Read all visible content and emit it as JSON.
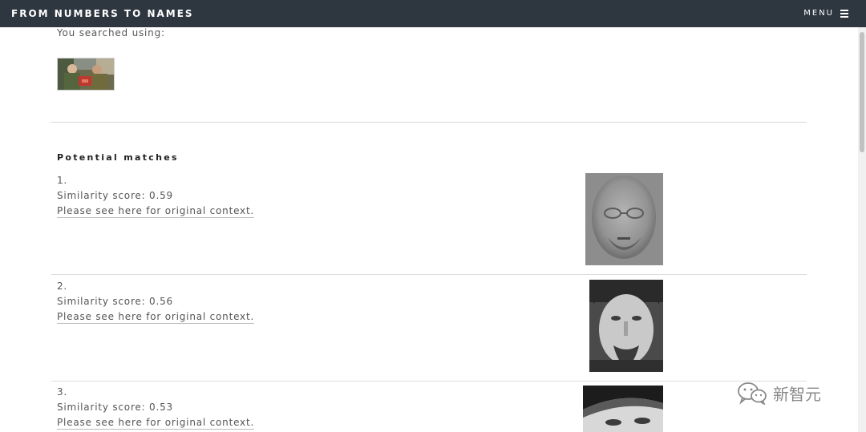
{
  "header": {
    "brand": "FROM NUMBERS TO NAMES",
    "menu_label": "MENU",
    "menu_icon": "hamburger-icon"
  },
  "search": {
    "label": "You searched using:"
  },
  "results": {
    "title": "Potential matches",
    "link_text": "Please see here for original context.",
    "matches": [
      {
        "rank": "1.",
        "score": "Similarity score: 0.59"
      },
      {
        "rank": "2.",
        "score": "Similarity score: 0.56"
      },
      {
        "rank": "3.",
        "score": "Similarity score: 0.53"
      }
    ]
  },
  "watermark": {
    "text": "新智元",
    "icon": "wechat-logo"
  },
  "colors": {
    "topbar": "#2e3640",
    "text": "#555555",
    "heading": "#222222",
    "divider": "#dddddd"
  }
}
